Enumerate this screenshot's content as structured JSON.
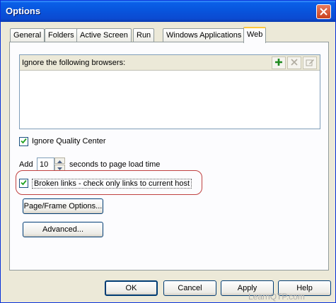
{
  "window": {
    "title": "Options"
  },
  "tabs": [
    {
      "label": "General"
    },
    {
      "label": "Folders"
    },
    {
      "label": "Active Screen"
    },
    {
      "label": "Run"
    },
    {
      "label": "Windows Applications"
    },
    {
      "label": "Web"
    }
  ],
  "browsers": {
    "label": "Ignore the following browsers:",
    "add_icon": "plus-icon",
    "delete_icon": "x-icon",
    "edit_icon": "edit-icon",
    "items": []
  },
  "ignore_qc": {
    "label": "Ignore Quality Center",
    "checked": true
  },
  "page_load": {
    "prefix": "Add",
    "value": "10",
    "suffix": "seconds to page load time"
  },
  "broken_links": {
    "label": "Broken links - check only links to current host",
    "checked": true
  },
  "buttons": {
    "page_frame": "Page/Frame Options...",
    "advanced": "Advanced...",
    "ok": "OK",
    "cancel": "Cancel",
    "apply": "Apply",
    "help": "Help"
  },
  "watermark": "LearnQTP.com",
  "colors": {
    "titlebar": "#0855dd",
    "accent_tab": "#ffc73c",
    "highlight": "#c04040"
  }
}
